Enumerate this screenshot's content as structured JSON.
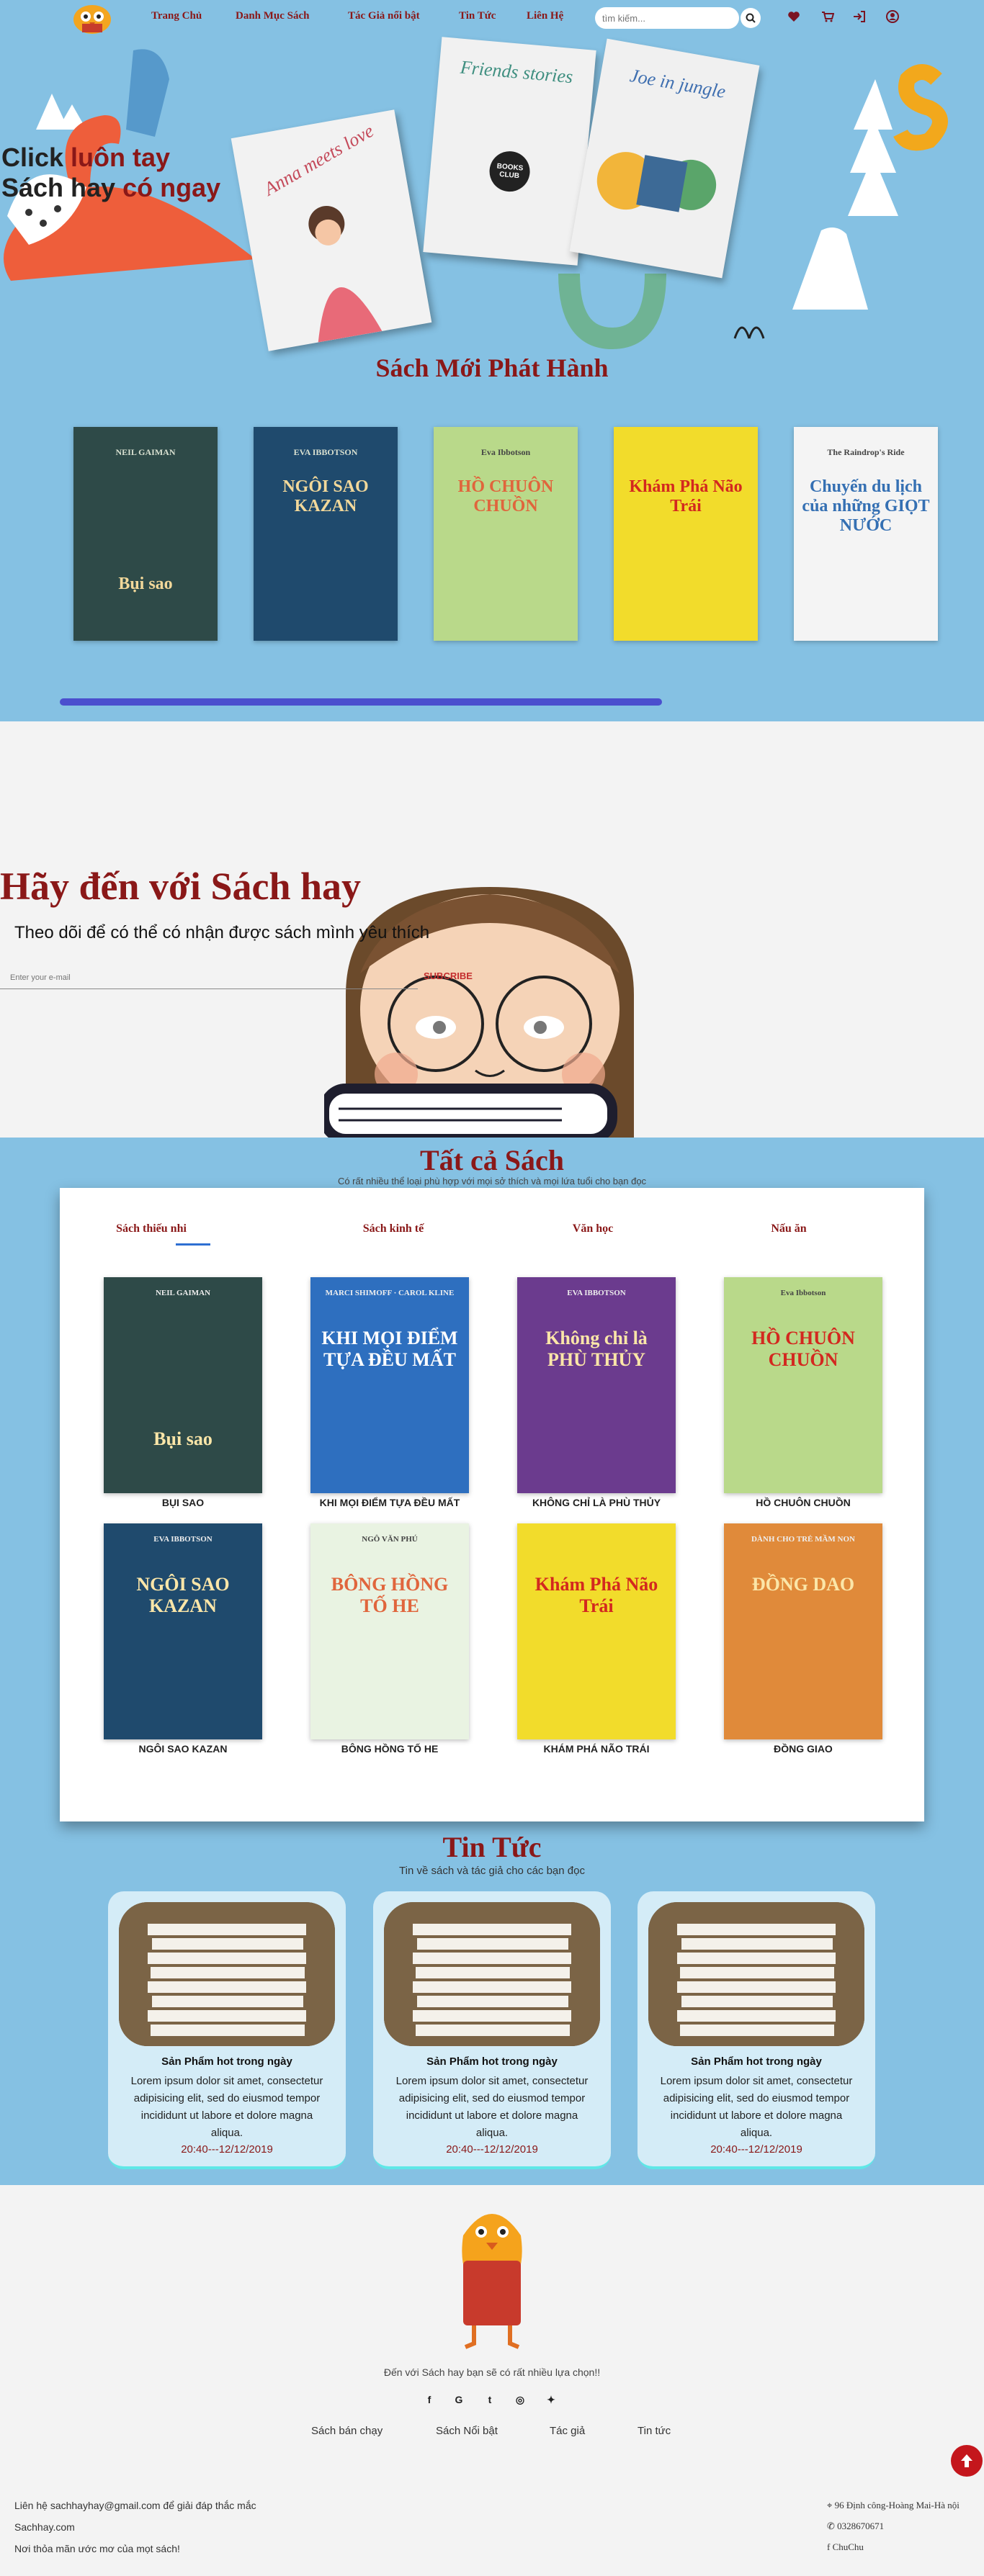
{
  "nav": {
    "items": [
      "Trang Chủ",
      "Danh Mục Sách",
      "Tác Giả nổi bật",
      "Tin Tức",
      "Liên Hệ"
    ],
    "search_placeholder": "tìm kiếm..."
  },
  "hero": {
    "slogan_line1_a": "Click ",
    "slogan_line1_b": "luôn tay",
    "slogan_line2_a": "Sách hay ",
    "slogan_line2_b": "có ngay",
    "book_titles": [
      "Anna meets love",
      "Friends stories",
      "Joe in jungle"
    ],
    "book_badge": "BOOKS CLUB",
    "new_title": "Sách Mới Phát Hành"
  },
  "new_books": [
    {
      "title": "Bụi sao",
      "author": "NEIL GAIMAN",
      "bg": "#2e4a48"
    },
    {
      "title": "NGÔI SAO KAZAN",
      "author": "EVA IBBOTSON",
      "bg": "#1f4a6d"
    },
    {
      "title": "HỒ CHUÔN CHUỒN",
      "author": "Eva Ibbotson",
      "bg": "#b9d98a"
    },
    {
      "title": "Khám Phá Não Trái",
      "author": "",
      "bg": "#f2dc2b"
    },
    {
      "title": "Chuyến du lịch của những GIỌT NƯỚC",
      "author": "The Raindrop's Ride",
      "bg": "#f4f4f4"
    }
  ],
  "subscribe": {
    "title": "Hãy đến với Sách hay",
    "subtitle": "Theo dõi để có thể có nhận được sách mình yêu thích",
    "placeholder": "Enter your e-mail",
    "button": "SUBCRIBE"
  },
  "all_books": {
    "title": "Tất cả Sách",
    "subtitle": "Có rất nhiều thể loại phù hợp với mọi sở thích và mọi lứa tuổi cho bạn đọc",
    "tabs": [
      "Sách thiếu nhi",
      "Sách kinh tế",
      "Văn học",
      "Nấu ăn"
    ],
    "books": [
      {
        "caption": "BỤI SAO",
        "cover": "Bụi sao",
        "top": "NEIL GAIMAN",
        "bg": "#2e4a48"
      },
      {
        "caption": "KHI MỌI ĐIỂM TỰA ĐỀU MẤT",
        "cover": "KHI MỌI ĐIỂM TỰA ĐỀU MẤT",
        "top": "MARCI SHIMOFF · CAROL KLINE",
        "bg": "#2e6fbf"
      },
      {
        "caption": "KHÔNG CHỈ LÀ PHÙ THỦY",
        "cover": "Không chỉ là PHÙ THỦY",
        "top": "EVA IBBOTSON",
        "bg": "#6b3b8e"
      },
      {
        "caption": "HỒ CHUÔN CHUỒN",
        "cover": "HỒ CHUÔN CHUỒN",
        "top": "Eva Ibbotson",
        "bg": "#b9d98a"
      },
      {
        "caption": "NGÔI SAO KAZAN",
        "cover": "NGÔI SAO KAZAN",
        "top": "EVA IBBOTSON",
        "bg": "#1f4a6d"
      },
      {
        "caption": "BÔNG HỒNG TỐ HE",
        "cover": "BÔNG HỒNG TỐ HE",
        "top": "NGÔ VĂN PHÚ",
        "bg": "#e9f3e2"
      },
      {
        "caption": "KHÁM PHÁ NÃO TRÁI",
        "cover": "Khám Phá Não Trái",
        "top": "",
        "bg": "#f2dc2b"
      },
      {
        "caption": "ĐỒNG GIAO",
        "cover": "ĐỒNG DAO",
        "top": "DÀNH CHO TRẺ MẦM NON",
        "bg": "#e08a3a"
      }
    ]
  },
  "news": {
    "title": "Tin Tức",
    "subtitle": "Tin về sách và tác giả cho các bạn đọc",
    "items": [
      {
        "title": "Sản Phẩm hot trong ngày",
        "desc": "Lorem ipsum dolor sit amet, consectetur adipisicing elit, sed do eiusmod tempor incididunt ut labore et dolore magna aliqua.",
        "date": "20:40---12/12/2019"
      },
      {
        "title": "Sản Phẩm hot trong ngày",
        "desc": "Lorem ipsum dolor sit amet, consectetur adipisicing elit, sed do eiusmod tempor incididunt ut labore et dolore magna aliqua.",
        "date": "20:40---12/12/2019"
      },
      {
        "title": "Sản Phẩm hot trong ngày",
        "desc": "Lorem ipsum dolor sit amet, consectetur adipisicing elit, sed do eiusmod tempor incididunt ut labore et dolore magna aliqua.",
        "date": "20:40---12/12/2019"
      }
    ]
  },
  "footer": {
    "tagline": "Đến với Sách hay bạn sẽ có rất nhiều lựa chọn!!",
    "social": [
      "f",
      "G",
      "t",
      "ig",
      "tw"
    ],
    "links": [
      "Sách bán chạy",
      "Sách Nổi bật",
      "Tác giả",
      "Tin tức"
    ],
    "contact": [
      "Liên hệ sachhayhay@gmail.com để giải đáp thắc mắc",
      "Sachhay.com",
      "Nơi thỏa mãn ước mơ của mọt sách!"
    ],
    "address": "96 Định công-Hoàng Mai-Hà nội",
    "phone": "0328670671",
    "fb": "ChuChu"
  },
  "colors": {
    "brand": "#8a1818",
    "hero_bg": "#85c1e3",
    "accent": "#4b4fce"
  }
}
